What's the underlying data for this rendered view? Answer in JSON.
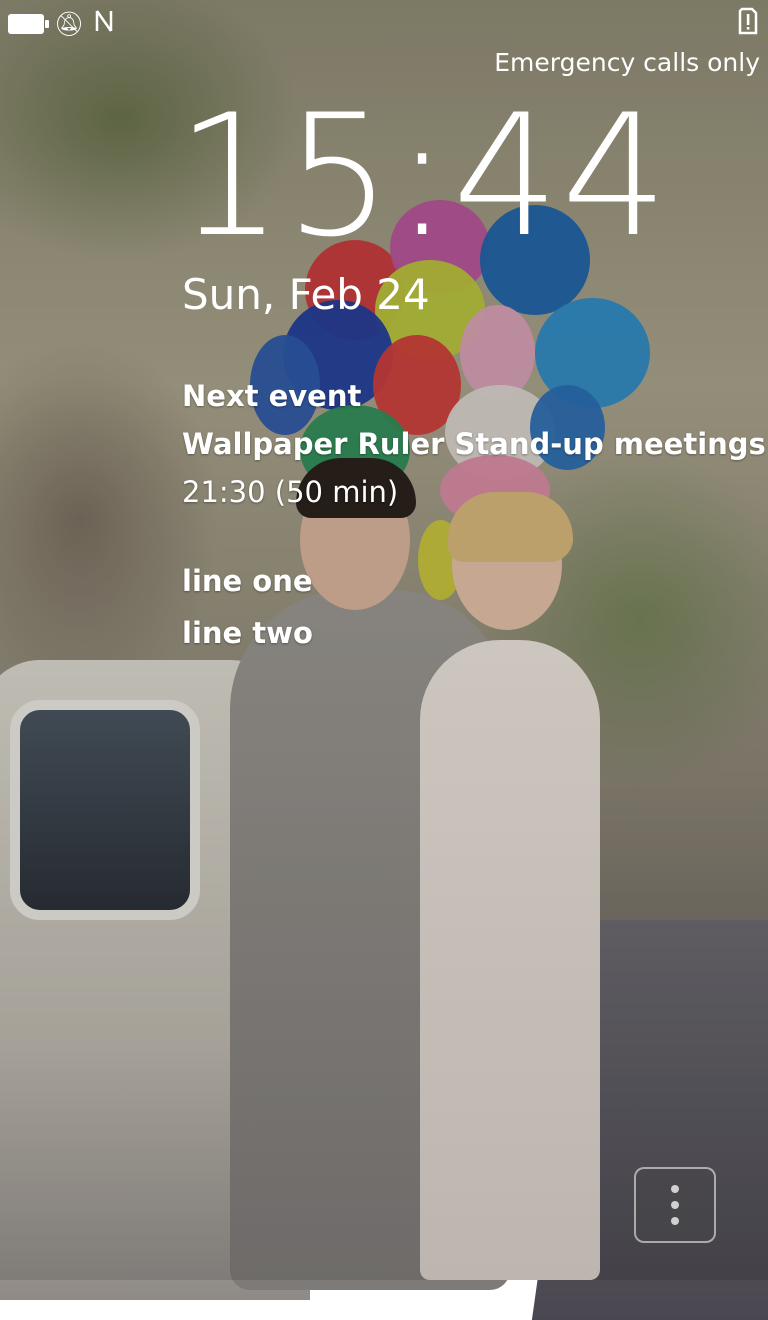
{
  "status_bar": {
    "icons": [
      "battery-icon",
      "bell-muted-icon",
      "nfc-icon"
    ],
    "right_icon": "sim-alert-icon"
  },
  "lockscreen": {
    "emergency_text": "Emergency calls only",
    "clock": "15:44",
    "date": "Sun, Feb 24",
    "event": {
      "header": "Next event",
      "title": "Wallpaper Ruler Stand-up meetings",
      "time": "21:30 (50 min)"
    },
    "extra_lines": [
      "line one",
      "line two"
    ]
  },
  "menu_button": {
    "icon": "overflow-menu-icon"
  },
  "colors": {
    "text": "#ffffff"
  }
}
